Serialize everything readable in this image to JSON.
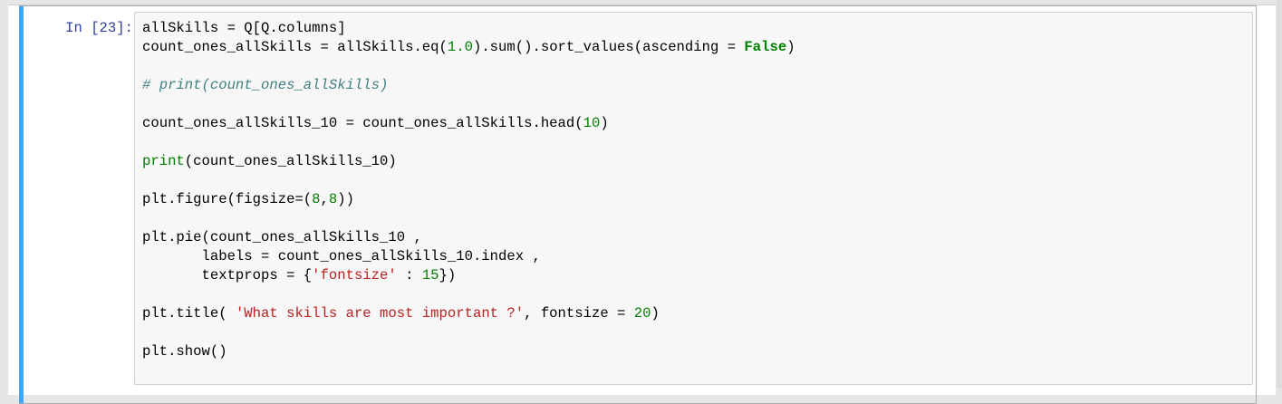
{
  "cell": {
    "prompt": "In [23]:",
    "lines": [
      [
        [
          "allSkills = Q[Q.columns]",
          ""
        ]
      ],
      [
        [
          "count_ones_allSkills = allSkills.eq(",
          ""
        ],
        [
          "1.0",
          "num"
        ],
        [
          ").sum().sort_values(ascending = ",
          ""
        ],
        [
          "False",
          "kw"
        ],
        [
          ")",
          ""
        ]
      ],
      [],
      [
        [
          "# print(count_ones_allSkills)",
          "cm"
        ]
      ],
      [],
      [
        [
          "count_ones_allSkills_10 = count_ones_allSkills.head(",
          ""
        ],
        [
          "10",
          "num"
        ],
        [
          ")",
          ""
        ]
      ],
      [],
      [
        [
          "print",
          "bi"
        ],
        [
          "(count_ones_allSkills_10)",
          ""
        ]
      ],
      [],
      [
        [
          "plt.figure(figsize=(",
          ""
        ],
        [
          "8",
          "num"
        ],
        [
          ",",
          ""
        ],
        [
          "8",
          "num"
        ],
        [
          "))",
          ""
        ]
      ],
      [],
      [
        [
          "plt.pie(count_ones_allSkills_10 ,",
          ""
        ]
      ],
      [
        [
          "       labels = count_ones_allSkills_10.index ,",
          ""
        ]
      ],
      [
        [
          "       textprops = {",
          ""
        ],
        [
          "'fontsize'",
          "str"
        ],
        [
          " : ",
          ""
        ],
        [
          "15",
          "num"
        ],
        [
          "})",
          ""
        ]
      ],
      [],
      [
        [
          "plt.title( ",
          ""
        ],
        [
          "'What skills are most important ?'",
          "str"
        ],
        [
          ", fontsize = ",
          ""
        ],
        [
          "20",
          "num"
        ],
        [
          ")",
          ""
        ]
      ],
      [],
      [
        [
          "plt.show()",
          ""
        ]
      ]
    ]
  },
  "colors": {
    "accent": "#42a5f5",
    "prompt": "#303f9f",
    "keyword": "#008000",
    "string": "#ba2121",
    "comment": "#408080"
  }
}
